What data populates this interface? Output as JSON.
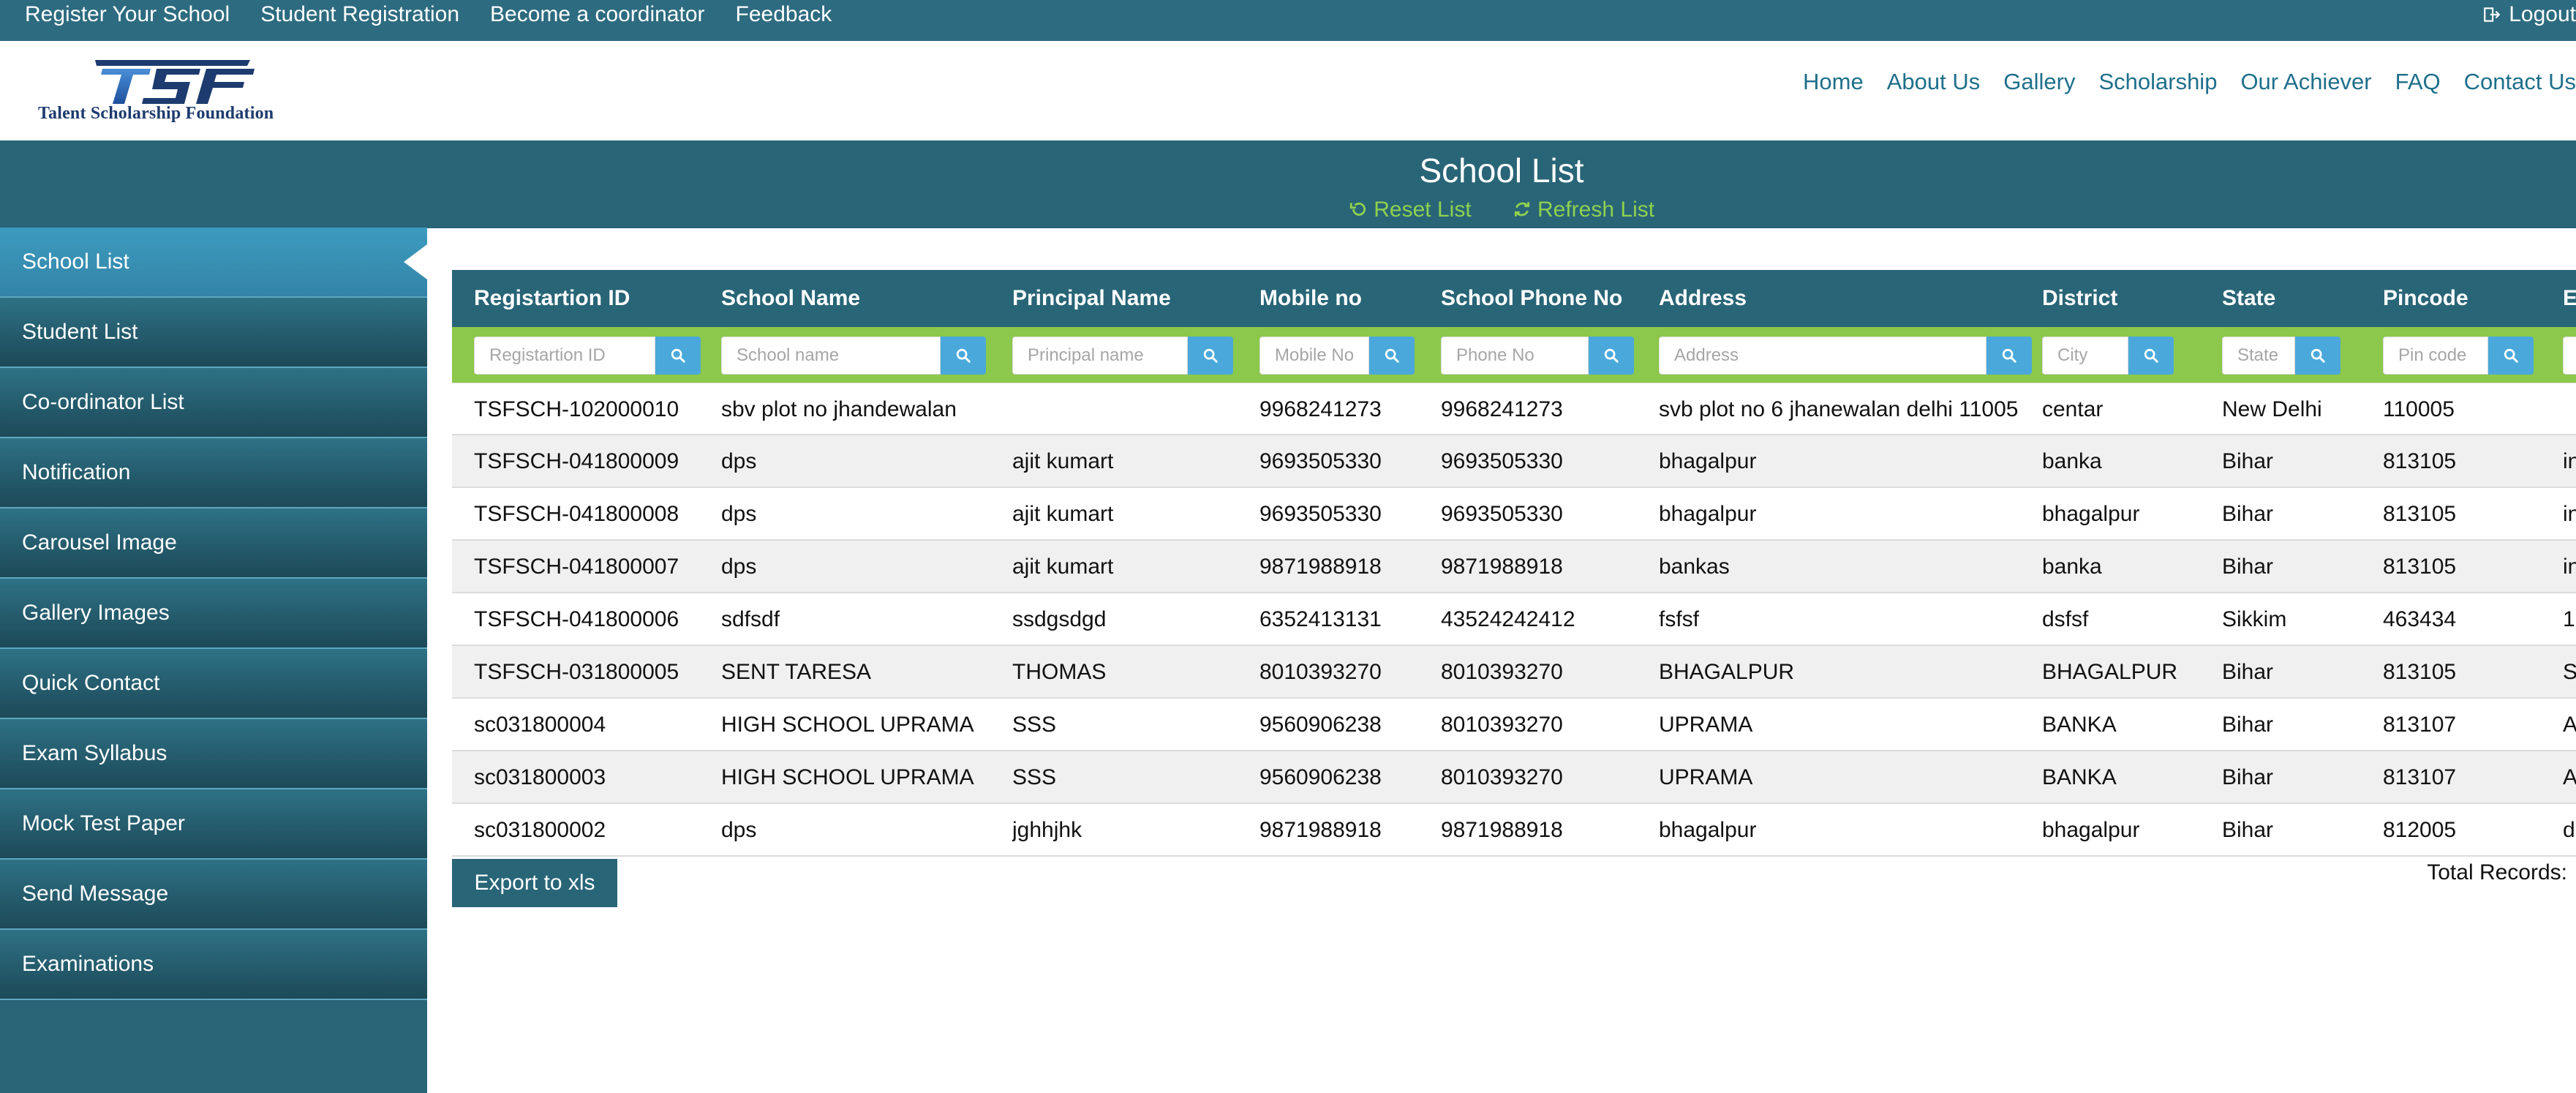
{
  "topbar": {
    "links": [
      "Register Your School",
      "Student Registration",
      "Become a coordinator",
      "Feedback"
    ],
    "logout": "Logout"
  },
  "header": {
    "logo_text": "TSF",
    "logo_tagline": "Talent Scholarship Foundation",
    "nav": [
      "Home",
      "About Us",
      "Gallery",
      "Scholarship",
      "Our Achiever",
      "FAQ",
      "Contact Us"
    ]
  },
  "sidebar": {
    "items": [
      "School List",
      "Student List",
      "Co-ordinator List",
      "Notification",
      "Carousel Image",
      "Gallery Images",
      "Quick Contact",
      "Exam Syllabus",
      "Mock Test Paper",
      "Send Message",
      "Examinations"
    ],
    "active": "School List"
  },
  "page": {
    "title": "School List",
    "reset": "Reset List",
    "refresh": "Refresh List"
  },
  "table": {
    "columns": [
      "Registartion ID",
      "School Name",
      "Principal Name",
      "Mobile no",
      "School Phone No",
      "Address",
      "District",
      "State",
      "Pincode",
      "E"
    ],
    "filters": [
      "Registartion ID",
      "School name",
      "Principal name",
      "Mobile No",
      "Phone No",
      "Address",
      "City",
      "State",
      "Pin code",
      ""
    ],
    "rows": [
      [
        "TSFSCH-102000010",
        "sbv plot no jhandewalan",
        "",
        "9968241273",
        "9968241273",
        "svb plot no 6 jhanewalan delhi 11005",
        "centar",
        "New Delhi",
        "110005",
        ""
      ],
      [
        "TSFSCH-041800009",
        "dps",
        "ajit kumart",
        "9693505330",
        "9693505330",
        "bhagalpur",
        "banka",
        "Bihar",
        "813105",
        "in"
      ],
      [
        "TSFSCH-041800008",
        "dps",
        "ajit kumart",
        "9693505330",
        "9693505330",
        "bhagalpur",
        "bhagalpur",
        "Bihar",
        "813105",
        "in"
      ],
      [
        "TSFSCH-041800007",
        "dps",
        "ajit kumart",
        "9871988918",
        "9871988918",
        "bankas",
        "banka",
        "Bihar",
        "813105",
        "in"
      ],
      [
        "TSFSCH-041800006",
        "sdfsdf",
        "ssdgsdgd",
        "6352413131",
        "43524242412",
        "fsfsf",
        "dsfsf",
        "Sikkim",
        "463434",
        "1"
      ],
      [
        "TSFSCH-031800005",
        "SENT TARESA",
        "THOMAS",
        "8010393270",
        "8010393270",
        "BHAGALPUR",
        "BHAGALPUR",
        "Bihar",
        "813105",
        "S"
      ],
      [
        "sc031800004",
        "HIGH SCHOOL UPRAMA",
        "SSS",
        "9560906238",
        "8010393270",
        "UPRAMA",
        "BANKA",
        "Bihar",
        "813107",
        "A"
      ],
      [
        "sc031800003",
        "HIGH SCHOOL UPRAMA",
        "SSS",
        "9560906238",
        "8010393270",
        "UPRAMA",
        "BANKA",
        "Bihar",
        "813107",
        "A"
      ],
      [
        "sc031800002",
        "dps",
        "jghhjhk",
        "9871988918",
        "9871988918",
        "bhagalpur",
        "bhagalpur",
        "Bihar",
        "812005",
        "d"
      ]
    ]
  },
  "footer": {
    "export": "Export to xls",
    "total": "Total Records:"
  },
  "colors": {
    "primary": "#286577",
    "filter_bar": "#8cc84b",
    "search_button": "#4aa9da",
    "accent_text": "#8fd14f",
    "nav_link": "#1f6f8b"
  }
}
